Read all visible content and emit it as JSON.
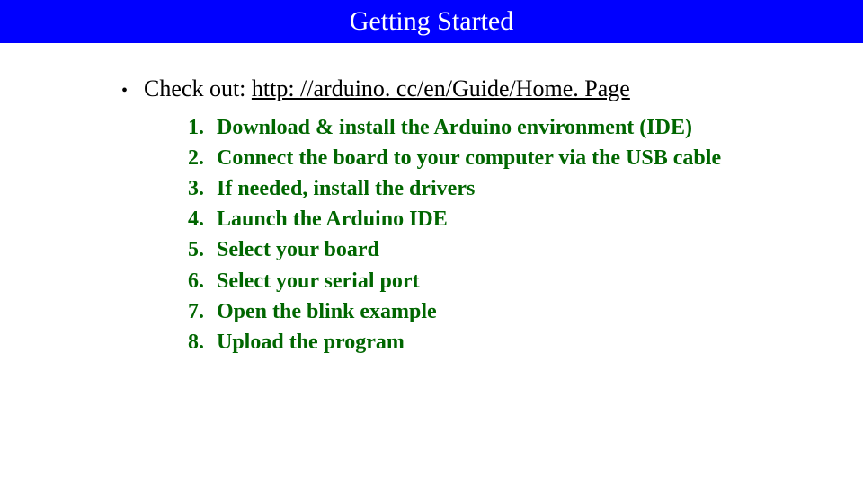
{
  "title": "Getting Started",
  "bullet": {
    "lead": "Check out: ",
    "link": "http: //arduino. cc/en/Guide/Home. Page"
  },
  "steps": [
    "Download & install the Arduino environment (IDE)",
    "Connect the board to your computer via the USB cable",
    "If needed, install the drivers",
    "Launch the Arduino IDE",
    "Select your board",
    "Select your serial port",
    "Open the blink example",
    "Upload the program"
  ]
}
